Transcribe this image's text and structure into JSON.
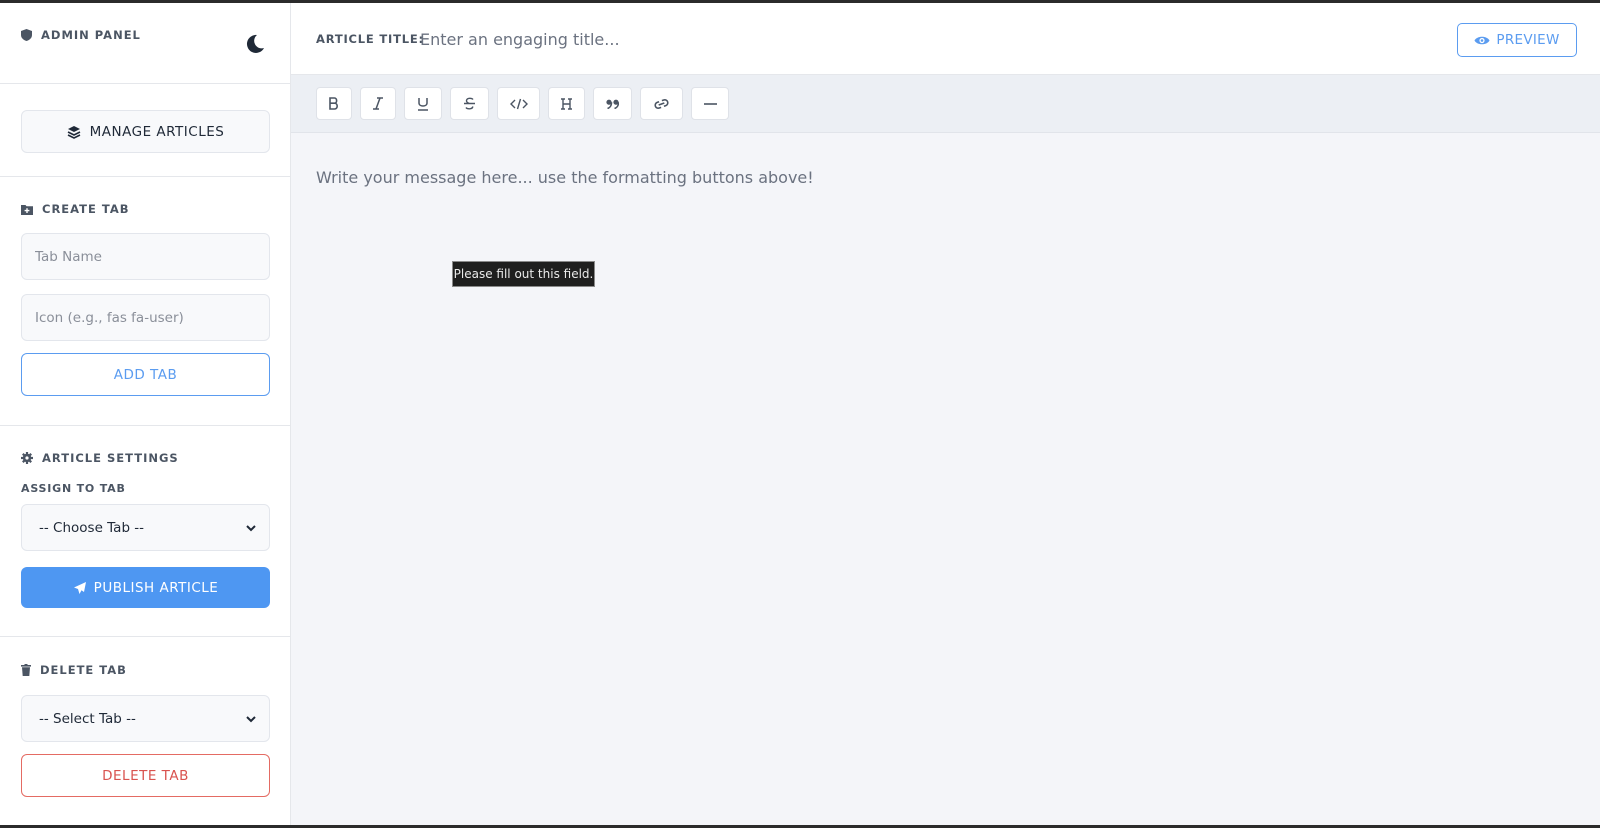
{
  "sidebar": {
    "brand_label": "ADMIN PANEL",
    "manage_label": "MANAGE ARTICLES",
    "create_tab": {
      "title": "CREATE TAB",
      "tab_name_placeholder": "Tab Name",
      "icon_placeholder": "Icon (e.g., fas fa-user)",
      "add_label": "ADD TAB"
    },
    "article_settings": {
      "title": "ARTICLE SETTINGS",
      "assign_label": "ASSIGN TO TAB",
      "selected": "-- Choose Tab --",
      "publish_label": "PUBLISH ARTICLE"
    },
    "delete_tab": {
      "title": "DELETE TAB",
      "selected": "-- Select Tab --",
      "delete_label": "DELETE TAB"
    }
  },
  "header": {
    "title_label": "ARTICLE TITLE:",
    "title_placeholder": "Enter an engaging title...",
    "preview_label": "PREVIEW"
  },
  "toolbar": {
    "buttons": [
      "bold-icon",
      "italic-icon",
      "underline-icon",
      "strikethrough-icon",
      "code-icon",
      "heading-icon",
      "quote-icon",
      "link-icon",
      "horizontal-rule-icon"
    ]
  },
  "editor": {
    "placeholder": "Write your message here... use the formatting buttons above!"
  },
  "tooltip": {
    "text": "Please fill out this field."
  },
  "colors": {
    "accent": "#4e97f2",
    "danger": "#d9534f",
    "text_dark": "#1f2937",
    "label_gray": "#4b5563"
  }
}
